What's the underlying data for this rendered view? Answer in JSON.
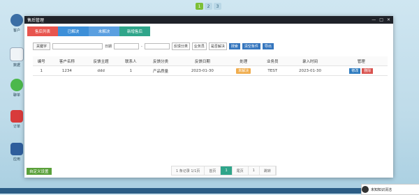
{
  "top_pager": {
    "pages": [
      "1",
      "2",
      "3"
    ]
  },
  "desktop_icons": [
    {
      "label": "客户"
    },
    {
      "label": "数据"
    },
    {
      "label": "聊单"
    },
    {
      "label": "订单"
    },
    {
      "label": "应用"
    }
  ],
  "window": {
    "title": "售后管理",
    "controls": {
      "minimize": "—",
      "maximize": "□",
      "close": "✕"
    }
  },
  "tabs": [
    "售后列表",
    "已解决",
    "未解决",
    "新增售后"
  ],
  "filters": {
    "keyword_label": "关键字",
    "keyword_placeholder": "",
    "date_label": "日期",
    "date_separator": "-",
    "category_select": "反馈分类",
    "salesperson_select": "业务员",
    "resolved_select": "是否解决",
    "search_button": "搜索",
    "clear_button": "清空条件",
    "export_button": "导出"
  },
  "table": {
    "headers": [
      "编号",
      "客户名称",
      "反馈主题",
      "联系人",
      "反馈分类",
      "反馈日期",
      "处理",
      "业务员",
      "录入时间",
      "管理"
    ],
    "rows": [
      {
        "id": "1",
        "customer": "1234",
        "topic": "ddd",
        "contact": "1",
        "category": "产品质量",
        "feedback_date": "2023-01-30",
        "status": "未解决",
        "salesperson": "TEST",
        "entry_time": "2023-01-30",
        "edit_label": "修改",
        "delete_label": "删除"
      }
    ]
  },
  "bottom": {
    "custom_settings": "自定义设置",
    "pager": {
      "summary": "1 条记录 1/1页",
      "first": "首页",
      "current": "1",
      "last": "尾页",
      "jump_value": "1",
      "jump": "跳转"
    }
  },
  "notification": {
    "text": "未知知识清洁"
  },
  "colors": {
    "accent_red": "#e8554e",
    "accent_blue": "#3d8fd8",
    "accent_green": "#2fa58a",
    "warning": "#f0ad4e"
  }
}
